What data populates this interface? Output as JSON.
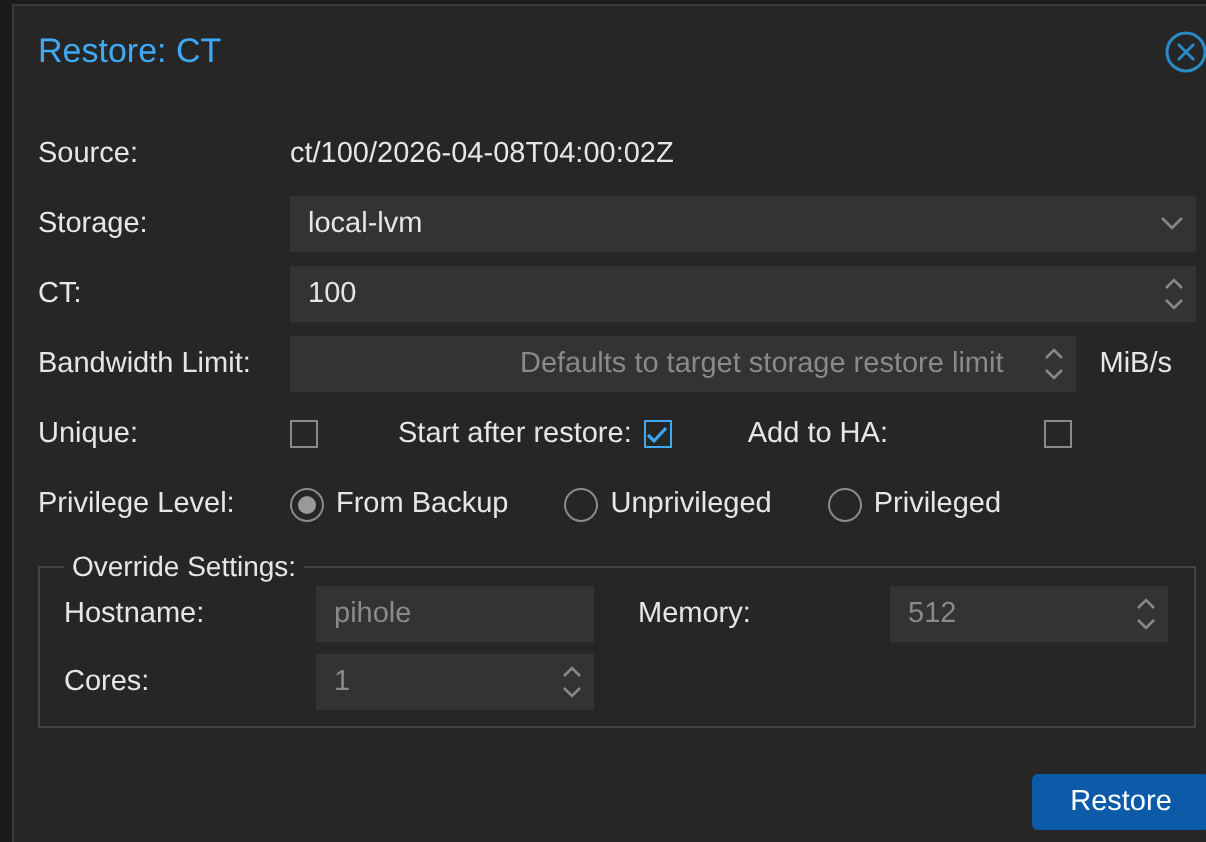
{
  "window": {
    "title": "Restore: CT"
  },
  "source": {
    "label": "Source:",
    "value": "ct/100/2026-04-08T04:00:02Z"
  },
  "storage": {
    "label": "Storage:",
    "value": "local-lvm"
  },
  "ct": {
    "label": "CT:",
    "value": "100"
  },
  "bandwidth": {
    "label": "Bandwidth Limit:",
    "placeholder": "Defaults to target storage restore limit",
    "unit": "MiB/s"
  },
  "options": [
    {
      "label": "Unique:",
      "checked": false
    },
    {
      "label": "Start after restore:",
      "checked": true
    },
    {
      "label": "Add to HA:",
      "checked": false
    }
  ],
  "privilege": {
    "label": "Privilege Level:",
    "choices": [
      {
        "label": "From Backup",
        "selected": true
      },
      {
        "label": "Unprivileged",
        "selected": false
      },
      {
        "label": "Privileged",
        "selected": false
      }
    ]
  },
  "override": {
    "legend": "Override Settings:",
    "fields": [
      {
        "label": "Hostname:",
        "placeholder": "pihole",
        "kind": "text"
      },
      {
        "label": "Memory:",
        "placeholder": "512",
        "kind": "spinner"
      },
      {
        "label": "Cores:",
        "placeholder": "1",
        "kind": "spinner"
      }
    ]
  },
  "buttons": [
    "Restore"
  ]
}
